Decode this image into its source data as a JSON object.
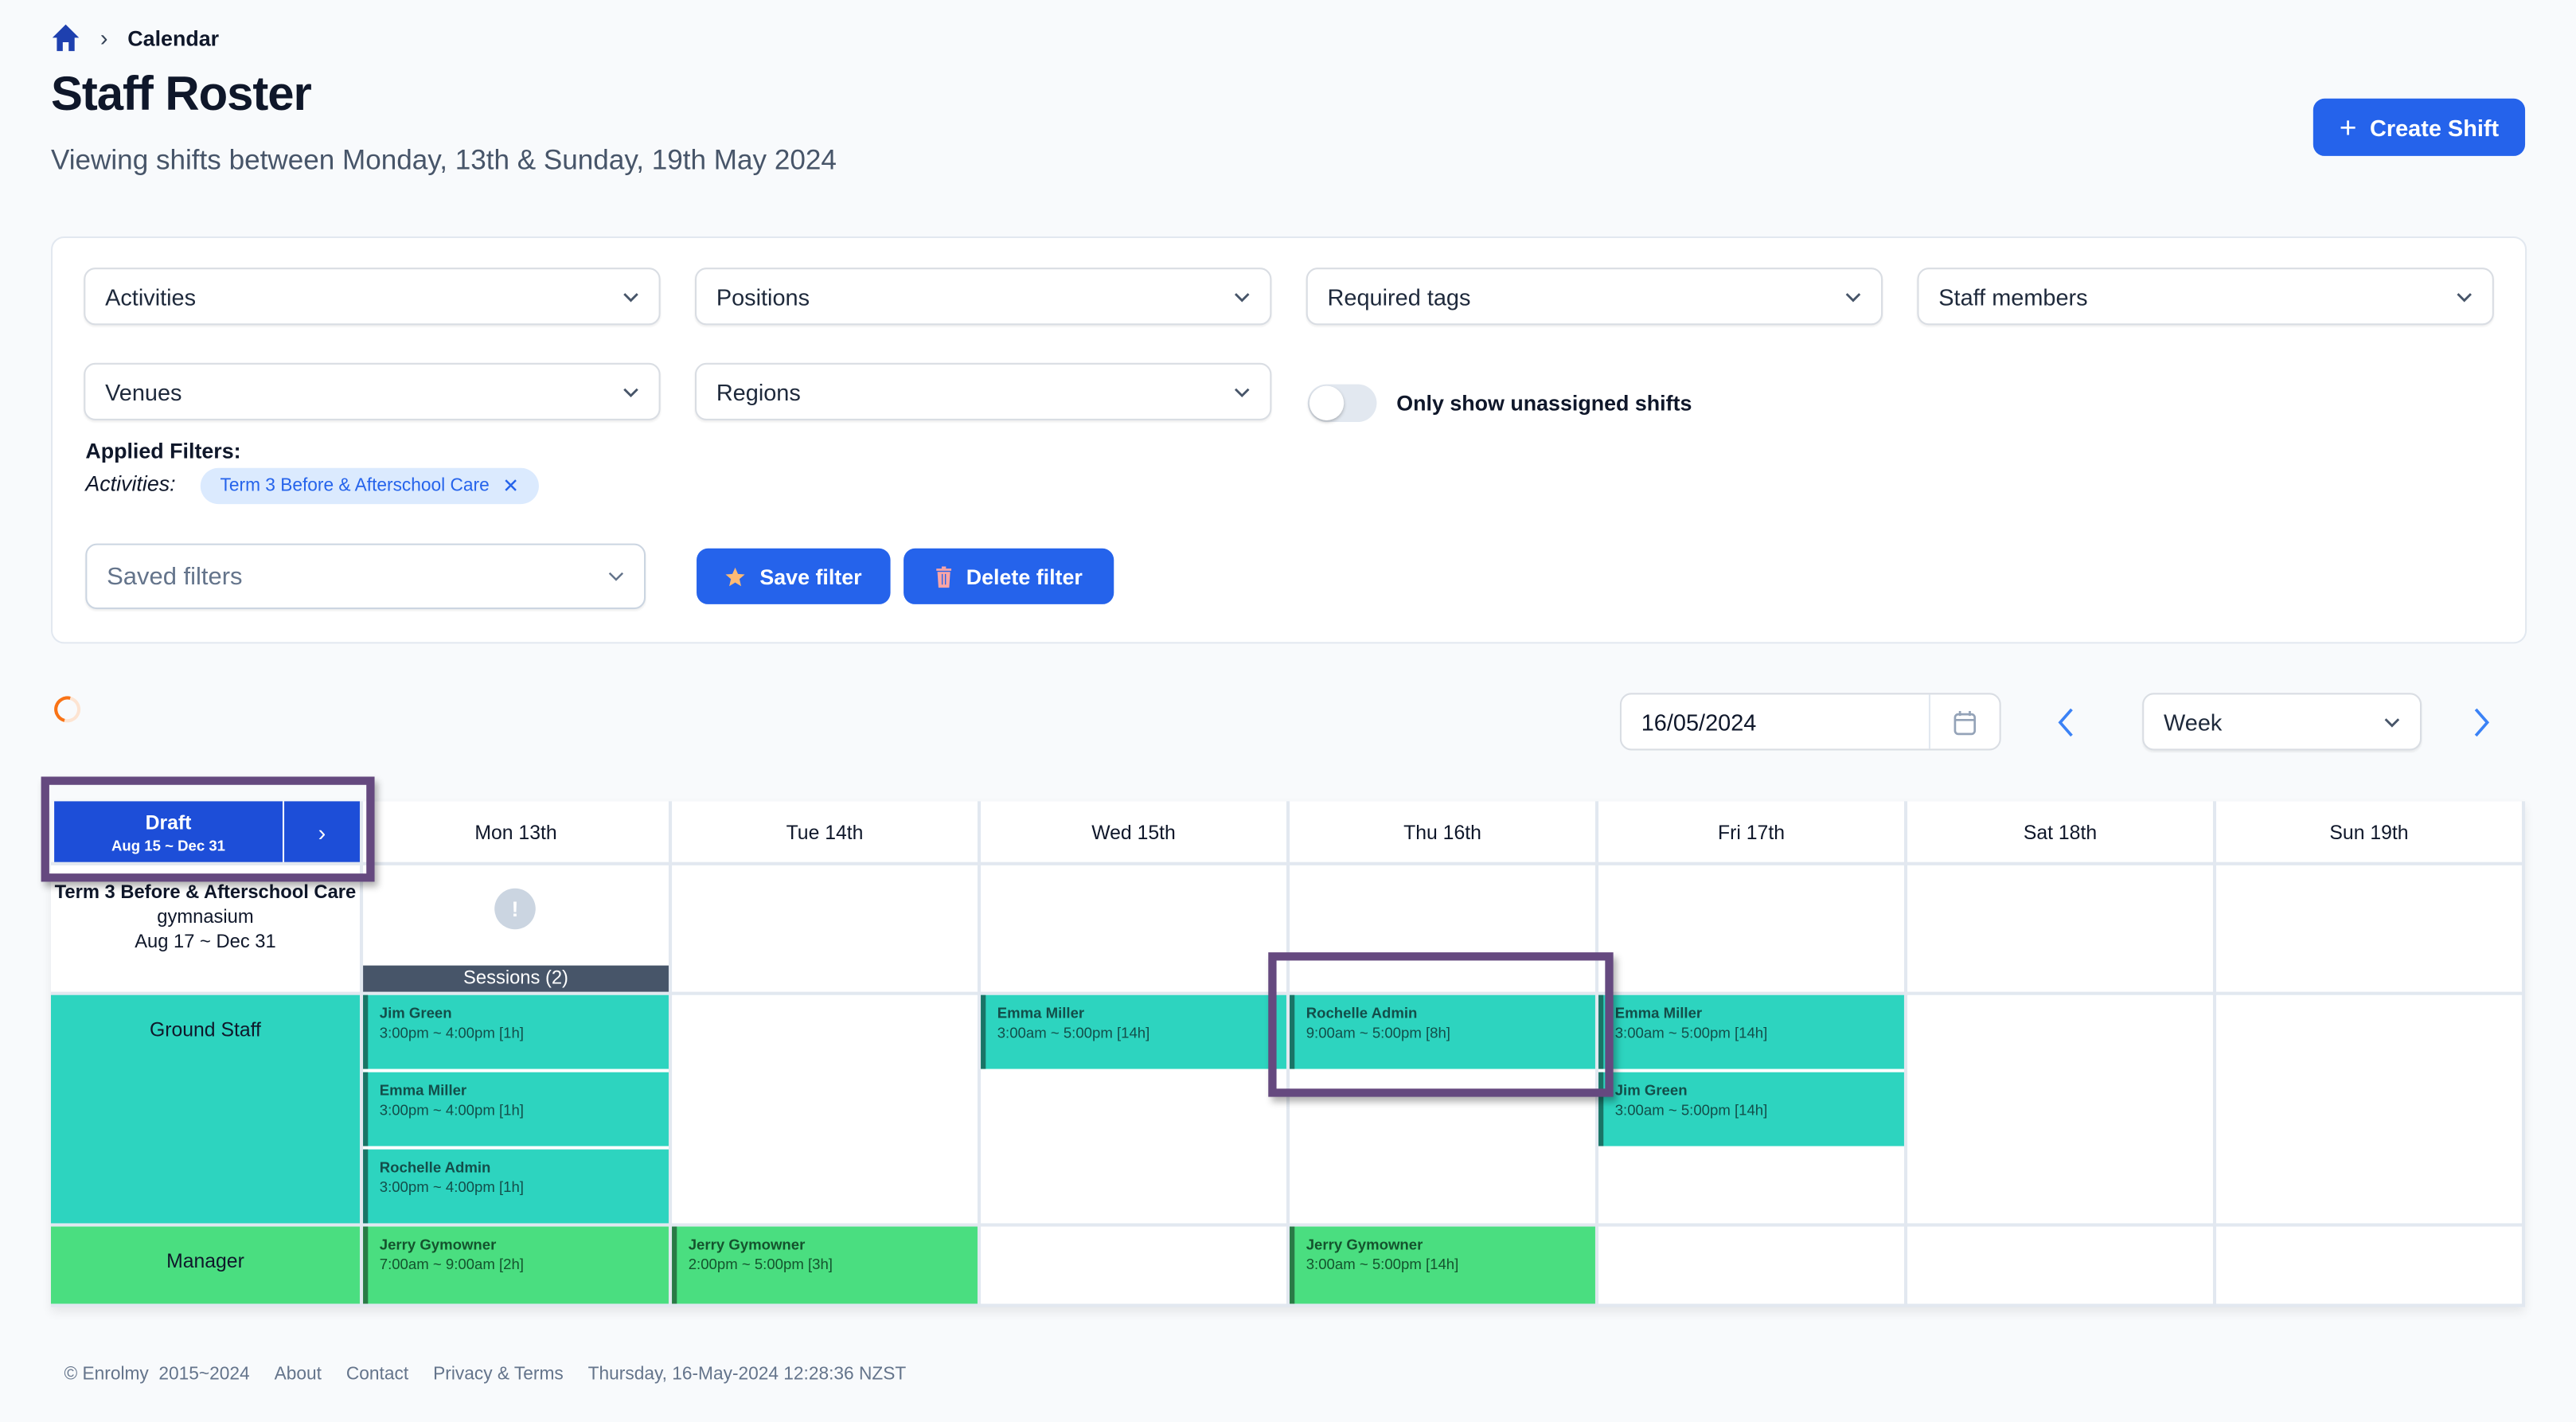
{
  "breadcrumb": {
    "home_icon": "home-icon",
    "separator_icon": "chevron-right-icon",
    "current": "Calendar"
  },
  "header": {
    "title": "Staff Roster",
    "subtitle": "Viewing shifts between Monday, 13th & Sunday, 19th May 2024",
    "create_button": {
      "icon": "plus-icon",
      "label": "Create Shift"
    }
  },
  "filters": {
    "dropdowns": [
      {
        "placeholder": "Activities"
      },
      {
        "placeholder": "Positions"
      },
      {
        "placeholder": "Required tags"
      },
      {
        "placeholder": "Staff members"
      },
      {
        "placeholder": "Venues"
      },
      {
        "placeholder": "Regions"
      }
    ],
    "unassigned_toggle": {
      "label": "Only show unassigned shifts",
      "on": false
    },
    "applied_title": "Applied Filters:",
    "applied": [
      {
        "group": "Activities:",
        "value": "Term 3 Before & Afterschool Care"
      }
    ],
    "saved_filters_placeholder": "Saved filters",
    "save_button": {
      "icon": "star-icon",
      "label": "Save filter",
      "icon_color": "#fdba74"
    },
    "delete_button": {
      "icon": "trash-icon",
      "label": "Delete filter",
      "icon_color": "#fca5a5"
    }
  },
  "toolbar": {
    "loading": true,
    "date_value": "16/05/2024",
    "view_value": "Week"
  },
  "calendar": {
    "roster_status": {
      "label": "Draft",
      "range": "Aug 15 ~ Dec 31"
    },
    "days": [
      "Mon 13th",
      "Tue 14th",
      "Wed 15th",
      "Thu 16th",
      "Fri 17th",
      "Sat 18th",
      "Sun 19th"
    ],
    "activity": {
      "name": "Term 3 Before & Afterschool Care",
      "venue": "gymnasium",
      "dates": "Aug 17 ~ Dec 31"
    },
    "sessions_label": "Sessions (2)",
    "roles": [
      {
        "name": "Ground Staff",
        "color": "#2dd4bf",
        "shifts": [
          {
            "day": 0,
            "slot": 0,
            "staff": "Jim Green",
            "time": "3:00pm ~ 4:00pm [1h]"
          },
          {
            "day": 0,
            "slot": 1,
            "staff": "Emma Miller",
            "time": "3:00pm ~ 4:00pm [1h]"
          },
          {
            "day": 0,
            "slot": 2,
            "staff": "Rochelle Admin",
            "time": "3:00pm ~ 4:00pm [1h]"
          },
          {
            "day": 2,
            "slot": 0,
            "staff": "Emma Miller",
            "time": "3:00am ~ 5:00pm [14h]"
          },
          {
            "day": 3,
            "slot": 0,
            "staff": "Rochelle Admin",
            "time": "9:00am ~ 5:00pm [8h]"
          },
          {
            "day": 4,
            "slot": 0,
            "staff": "Emma Miller",
            "time": "3:00am ~ 5:00pm [14h]"
          },
          {
            "day": 4,
            "slot": 1,
            "staff": "Jim Green",
            "time": "3:00am ~ 5:00pm [14h]"
          }
        ]
      },
      {
        "name": "Manager",
        "color": "#4ade80",
        "shifts": [
          {
            "day": 0,
            "slot": 0,
            "staff": "Jerry Gymowner",
            "time": "7:00am ~ 9:00am [2h]"
          },
          {
            "day": 1,
            "slot": 0,
            "staff": "Jerry Gymowner",
            "time": "2:00pm ~ 5:00pm [3h]"
          },
          {
            "day": 3,
            "slot": 0,
            "staff": "Jerry Gymowner",
            "time": "3:00am ~ 5:00pm [14h]"
          }
        ]
      }
    ]
  },
  "footer": {
    "copyright": "© Enrolmy  2015~2024",
    "links": [
      "About",
      "Contact",
      "Privacy & Terms"
    ],
    "timestamp": "Thursday, 16-May-2024 12:28:36 NZST"
  }
}
